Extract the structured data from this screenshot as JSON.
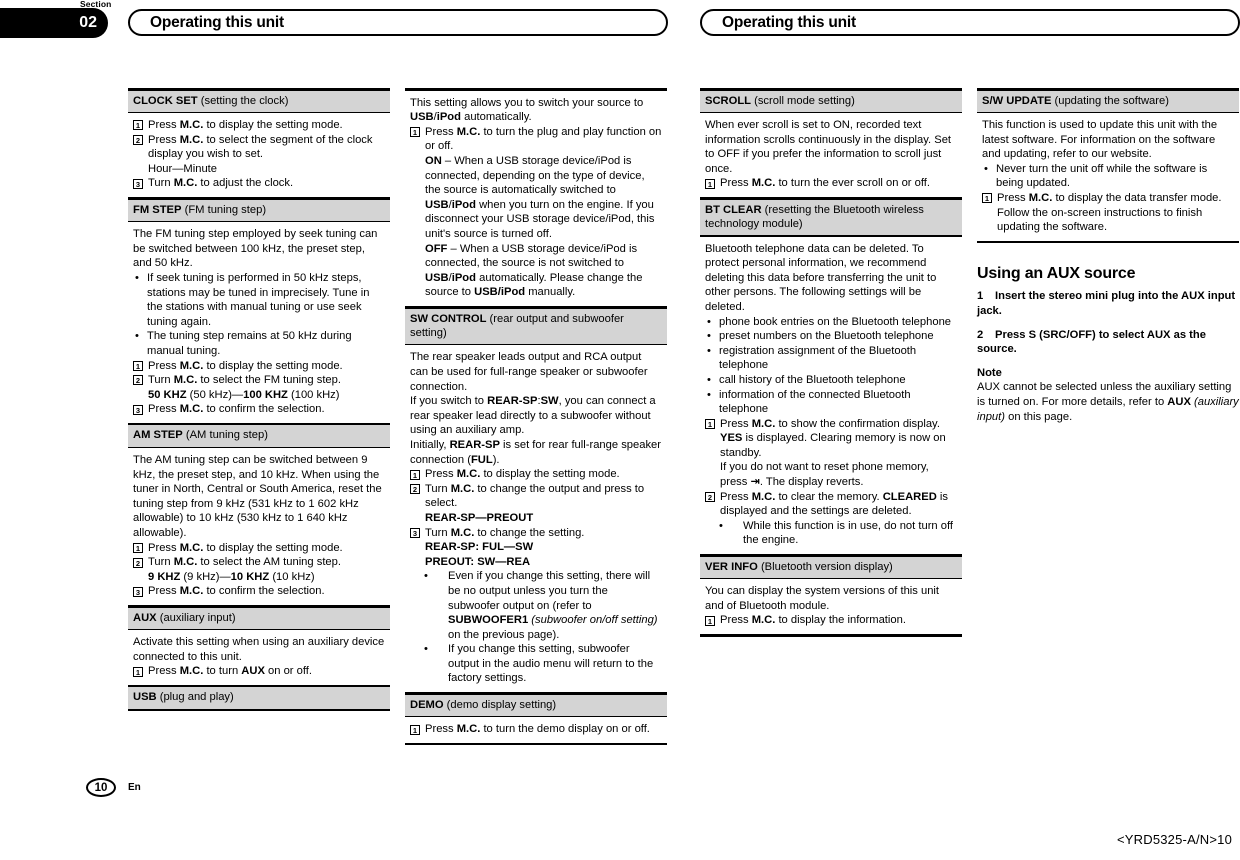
{
  "header": {
    "section_word": "Section",
    "section_number": "02",
    "title_left": "Operating this unit",
    "title_right": "Operating this unit"
  },
  "footer": {
    "page_number": "10",
    "language": "En",
    "doc_id": "<YRD5325-A/N>10"
  },
  "columns": {
    "col1": {
      "clock_set": {
        "name": "CLOCK SET",
        "desc": " (setting the clock)",
        "step1": "Press M.C. to display the setting mode.",
        "step2": "Press M.C. to select the segment of the clock display you wish to set.",
        "step2_cont": "Hour—Minute",
        "step3": "Turn M.C. to adjust the clock."
      },
      "fm_step": {
        "name": "FM STEP",
        "desc": " (FM tuning step)",
        "intro": "The FM tuning step employed by seek tuning can be switched between 100 kHz, the preset step, and 50 kHz.",
        "bullet1": "If seek tuning is performed in 50 kHz steps, stations may be tuned in imprecisely. Tune in the stations with manual tuning or use seek tuning again.",
        "bullet2": "The tuning step remains at 50 kHz during manual tuning.",
        "step1": "Press M.C. to display the setting mode.",
        "step2": "Turn M.C. to select the FM tuning step.",
        "step2_cont": "50 KHZ (50 kHz)—100 KHZ (100 kHz)",
        "step3": "Press M.C. to confirm the selection."
      },
      "am_step": {
        "name": "AM STEP",
        "desc": " (AM tuning step)",
        "intro": "The AM tuning step can be switched between 9 kHz, the preset step, and 10 kHz. When using the tuner in North, Central or South America, reset the tuning step from 9 kHz (531 kHz to 1 602 kHz allowable) to 10 kHz (530 kHz to 1 640 kHz allowable).",
        "step1": "Press M.C. to display the setting mode.",
        "step2": "Turn M.C. to select the AM tuning step.",
        "step2_cont": "9 KHZ (9 kHz)—10 KHZ (10 kHz)",
        "step3": "Press M.C. to confirm the selection."
      },
      "aux": {
        "name": "AUX",
        "desc": " (auxiliary input)",
        "intro": "Activate this setting when using an auxiliary device connected to this unit.",
        "step1": "Press M.C. to turn AUX on or off."
      },
      "usb": {
        "name": "USB",
        "desc": " (plug and play)"
      }
    },
    "col2": {
      "usb_cont": {
        "intro": "This setting allows you to switch your source to USB/iPod automatically.",
        "step1": "Press M.C. to turn the plug and play function on or off.",
        "on_text": "ON – When a USB storage device/iPod is connected, depending on the type of device, the source is automatically switched to  USB/iPod when you turn on the engine. If you disconnect your USB storage device/iPod, this unit's source is turned off.",
        "off_text": "OFF – When a USB storage device/iPod is connected, the source is not switched to USB/iPod automatically. Please change the source to USB/iPod manually."
      },
      "sw_control": {
        "name": "SW CONTROL",
        "desc": " (rear output and subwoofer setting)",
        "intro1": "The rear speaker leads output and RCA output can be used for full-range speaker or subwoofer connection.",
        "intro2": "If you switch to REAR-SP:SW, you can connect a rear speaker lead directly to a subwoofer without using an auxiliary amp.",
        "intro3": "Initially, REAR-SP is set for rear full-range speaker connection (FUL).",
        "step1": "Press M.C. to display the setting mode.",
        "step2": "Turn M.C. to change the output and press to select.",
        "step2_cont": "REAR-SP—PREOUT",
        "step3": "Turn M.C. to change the setting.",
        "step3_cont1": "REAR-SP: FUL—SW",
        "step3_cont2": "PREOUT: SW—REA",
        "bullet1": "Even if you change this setting, there will be no output unless you turn the subwoofer output on (refer to SUBWOOFER1 (subwoofer on/off setting) on the previous page).",
        "bullet2": "If you change this setting, subwoofer output in the audio menu will return to the factory settings."
      },
      "demo": {
        "name": "DEMO",
        "desc": " (demo display setting)",
        "step1": "Press M.C. to turn the demo display on or off."
      }
    },
    "col3": {
      "scroll": {
        "name": "SCROLL",
        "desc": " (scroll mode setting)",
        "intro": "When ever scroll is set to ON, recorded text information scrolls continuously in the display. Set to OFF if you prefer the information to scroll just once.",
        "step1": "Press M.C. to turn the ever scroll on or off."
      },
      "bt_clear": {
        "name": "BT CLEAR",
        "desc": " (resetting the Bluetooth wireless technology module)",
        "intro": "Bluetooth telephone data can be deleted. To protect personal information, we recommend deleting this data before transferring the unit to other persons. The following settings will be deleted.",
        "bullet1": "phone book entries on the Bluetooth telephone",
        "bullet2": "preset numbers on the Bluetooth telephone",
        "bullet3": "registration assignment of the Bluetooth telephone",
        "bullet4": "call history of the Bluetooth telephone",
        "bullet5": "information of the connected Bluetooth telephone",
        "step1": "Press M.C. to show the confirmation display.",
        "step1_cont1": "YES is displayed. Clearing memory is now on standby.",
        "step1_cont2": "If you do not want to reset phone memory, press ⇨. The display reverts.",
        "step2": "Press M.C. to clear the memory.",
        "step2_cont": "CLEARED is displayed and the settings are deleted.",
        "step2_bullet": "While this function is in use, do not turn off the engine."
      },
      "ver_info": {
        "name": "VER INFO",
        "desc": " (Bluetooth version display)",
        "intro": "You can display the system versions of this unit and of Bluetooth module.",
        "step1": "Press M.C. to display the information."
      }
    },
    "col4": {
      "sw_update": {
        "name": "S/W UPDATE",
        "desc": " (updating the software)",
        "intro": "This function is used to update this unit with the latest software. For information on the software and updating, refer to our website.",
        "bullet1": "Never turn the unit off while the software is being updated.",
        "step1": "Press M.C. to display the data transfer mode. Follow the on-screen instructions to finish updating the software."
      },
      "aux_source": {
        "heading": "Using an AUX source",
        "step1_num": "1",
        "step1": "Insert the stereo mini plug into the AUX input jack.",
        "step2_num": "2",
        "step2": "Press S (SRC/OFF) to select AUX as the source.",
        "note_head": "Note",
        "note_body": "AUX cannot be selected unless the auxiliary setting is turned on. For more details, refer to AUX (auxiliary input) on this page."
      }
    }
  },
  "colors": {
    "section_header_bg": "#d4d4d4",
    "rule": "#000000",
    "page_bg": "#ffffff"
  }
}
